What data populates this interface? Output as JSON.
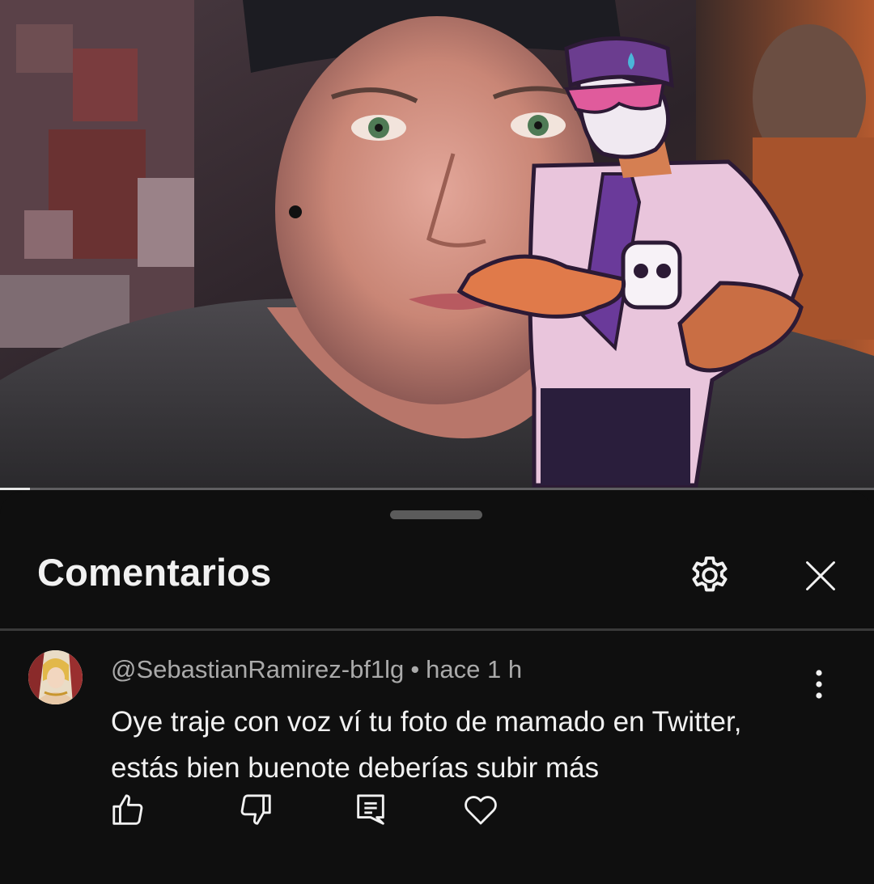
{
  "video": {
    "description_icon": "video-thumbnail",
    "progress_fraction": 0.034
  },
  "comments_panel": {
    "title": "Comentarios",
    "settings_icon": "gear-icon",
    "close_icon": "close-icon"
  },
  "comment": {
    "author": "@SebastianRamirez-bf1lg",
    "separator": "•",
    "time": "hace 1 h",
    "text": "Oye traje con voz ví tu foto de mamado en Twitter, estás bien buenote deberías subir más",
    "actions": {
      "like_icon": "thumbs-up-icon",
      "dislike_icon": "thumbs-down-icon",
      "reply_icon": "reply-icon",
      "heart_icon": "heart-icon",
      "more_icon": "more-vertical-icon"
    }
  },
  "colors": {
    "background": "#0f0f0f",
    "text_primary": "#f1f1f1",
    "text_secondary": "#aaaaaa"
  }
}
